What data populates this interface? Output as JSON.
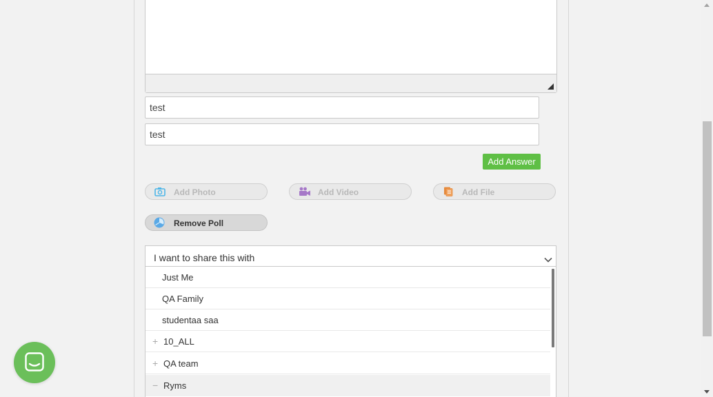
{
  "post_form": {
    "answers": [
      {
        "value": "test",
        "placeholder": ""
      },
      {
        "value": "test",
        "placeholder": ""
      }
    ],
    "add_answer_label": "Add Answer",
    "media_buttons": {
      "add_photo": "Add Photo",
      "add_video": "Add Video",
      "add_file": "Add File"
    },
    "remove_poll_label": "Remove Poll",
    "share": {
      "label": "I want to share this with",
      "options": [
        "Just Me",
        "QA Family",
        "studentaa saa"
      ],
      "groups": [
        {
          "name": "10_ALL",
          "sign": "+"
        },
        {
          "name": "QA team",
          "sign": "+"
        },
        {
          "name": "Ryms",
          "sign": "−"
        }
      ]
    }
  },
  "icons": {
    "photo": "camera-icon",
    "video": "video-camera-icon",
    "file": "file-icon",
    "poll": "poll-chart-icon",
    "share_chevron": "chevron-down-icon",
    "chat": "chat-icon"
  },
  "colors": {
    "accent_green": "#5fbf45",
    "chat_launcher": "#6bbf5a",
    "photo_icon": "#4db6e8",
    "video_icon": "#a678c8",
    "file_icon": "#e68a3c",
    "poll_icon": "#5aa9e6"
  }
}
